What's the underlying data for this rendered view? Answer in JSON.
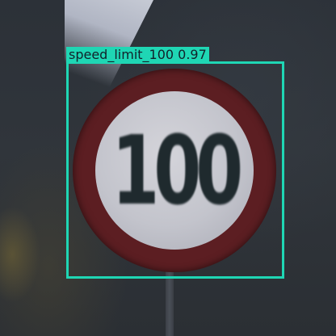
{
  "scene": {
    "sign_text": "100",
    "colors": {
      "sign_ring": "#5c1e22",
      "sign_face": "#c3c4cc",
      "sign_digits": "#1f2a2e",
      "detection": "#1fd6b4"
    }
  },
  "detection": {
    "label": "speed_limit_100 0.97",
    "class": "speed_limit_100",
    "confidence": 0.97
  }
}
